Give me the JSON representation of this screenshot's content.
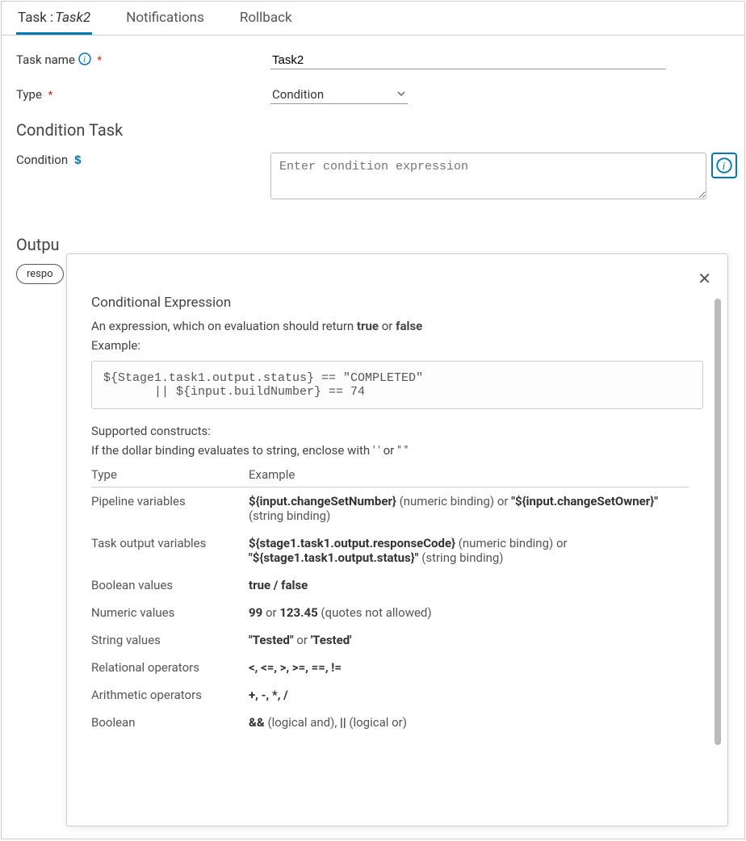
{
  "tabs": {
    "task_prefix": "Task :",
    "task_name": "Task2",
    "notifications": "Notifications",
    "rollback": "Rollback"
  },
  "form": {
    "task_name_label": "Task name",
    "task_name_value": "Task2",
    "type_label": "Type",
    "type_value": "Condition",
    "section_title": "Condition Task",
    "condition_label": "Condition",
    "condition_placeholder": "Enter condition expression"
  },
  "output": {
    "title": "Outpu",
    "chip": "respo"
  },
  "help": {
    "title": "Conditional Expression",
    "intro_pre": "An expression, which on evaluation should return ",
    "intro_true": "true",
    "intro_mid": " or ",
    "intro_false": "false",
    "example_label": "Example:",
    "example_code": "${Stage1.task1.output.status} == \"COMPLETED\"\n       || ${input.buildNumber} == 74",
    "supported_label": "Supported constructs:",
    "enclose_note": "If the dollar binding evaluates to string, enclose with ' ' or \" \"",
    "th_type": "Type",
    "th_example": "Example",
    "rows": [
      {
        "type": "Pipeline variables",
        "ex_b1": "${input.changeSetNumber}",
        "ex_t1": " (numeric binding) or ",
        "ex_b2": "\"${input.changeSetOwner}\"",
        "ex_t2": " (string binding)"
      },
      {
        "type": "Task output variables",
        "ex_b1": "${stage1.task1.output.responseCode}",
        "ex_t1": " (numeric binding) or ",
        "ex_b2": "\"${stage1.task1.output.status}\"",
        "ex_t2": " (string binding)"
      },
      {
        "type": "Boolean values",
        "ex_b1": "true / false",
        "ex_t1": "",
        "ex_b2": "",
        "ex_t2": ""
      },
      {
        "type": "Numeric values",
        "ex_b1": "99",
        "ex_t1": " or ",
        "ex_b2": "123.45",
        "ex_t2": " (quotes not allowed)"
      },
      {
        "type": "String values",
        "ex_b1": "\"Tested\"",
        "ex_t1": " or ",
        "ex_b2": "'Tested'",
        "ex_t2": ""
      },
      {
        "type": "Relational operators",
        "ex_b1": "<, <=, >, >=, ==, !=",
        "ex_t1": "",
        "ex_b2": "",
        "ex_t2": ""
      },
      {
        "type": "Arithmetic operators",
        "ex_b1": "+, -, *, /",
        "ex_t1": "",
        "ex_b2": "",
        "ex_t2": ""
      },
      {
        "type": "Boolean",
        "ex_b1": "&&",
        "ex_t1": " (logical and), ",
        "ex_b2": "||",
        "ex_t2": " (logical or)"
      }
    ]
  }
}
